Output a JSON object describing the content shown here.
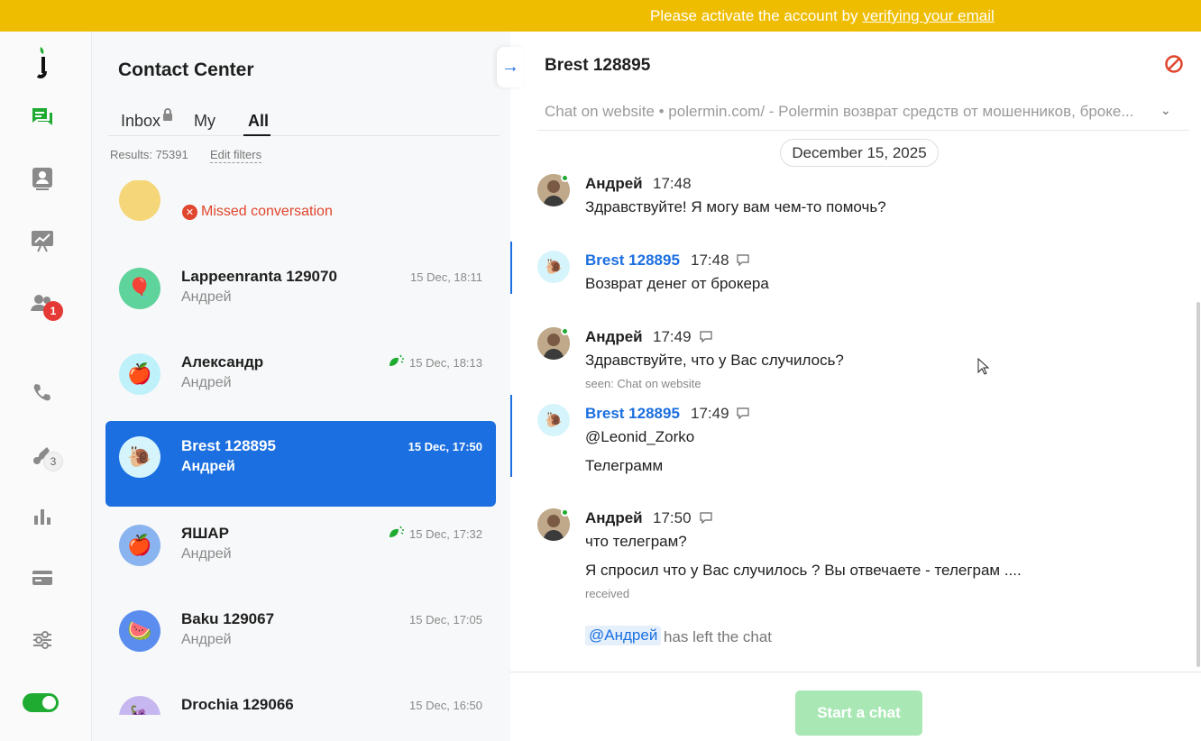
{
  "banner": {
    "prefix": "Please activate the account by ",
    "link": "verifying your email"
  },
  "nav": {
    "badge_contacts": "1",
    "badge_bots": "3"
  },
  "list": {
    "title": "Contact Center",
    "tabs": [
      {
        "label": "Inbox"
      },
      {
        "label": "My"
      },
      {
        "label": "All"
      }
    ],
    "active_tab": "All",
    "results": "Results: 75391",
    "edit_filters": "Edit filters",
    "missed": "Missed conversation",
    "items": [
      {
        "name": "Lappeenranta 129070",
        "sub": "Андрей",
        "time": "15 Dec, 18:11",
        "avatar": "balloon-icon",
        "color": "#5fd39c"
      },
      {
        "name": "Александр",
        "sub": "Андрей",
        "time": "15 Dec, 18:13",
        "avatar": "apple-icon",
        "color": "#bff1fb"
      },
      {
        "name": "Brest 128895",
        "sub": "Андрей",
        "time": "15 Dec, 17:50",
        "avatar": "snail-icon",
        "color": "#d6f4fb"
      },
      {
        "name": "ЯШАР",
        "sub": "Андрей",
        "time": "15 Dec, 17:32",
        "avatar": "apple-icon",
        "color": "#8ab4f0"
      },
      {
        "name": "Baku 129067",
        "sub": "Андрей",
        "time": "15 Dec, 17:05",
        "avatar": "watermelon-icon",
        "color": "#5b8def"
      },
      {
        "name": "Drochia 129066",
        "sub": "",
        "time": "15 Dec, 16:50",
        "avatar": "grapes-icon",
        "color": "#c7b7f0"
      }
    ]
  },
  "chat": {
    "title": "Brest 128895",
    "subtitle": "Chat on website • polermin.com/ - Polermin возврат средств от мошенников, броке...",
    "date": "December 15, 2025",
    "messages": [
      {
        "author": "Андрей",
        "time": "17:48",
        "lines": [
          "Здравствуйте! Я могу вам чем-то помочь?"
        ]
      },
      {
        "author": "Brest 128895",
        "time": "17:48",
        "lines": [
          "Возврат денег от брокера"
        ]
      },
      {
        "author": "Андрей",
        "time": "17:49",
        "lines": [
          "Здравствуйте, что у Вас случилось?"
        ],
        "note": "seen: Chat on website"
      },
      {
        "author": "Brest 128895",
        "time": "17:49",
        "lines": [
          "@Leonid_Zorko",
          "Телеграмм"
        ]
      },
      {
        "author": "Андрей",
        "time": "17:50",
        "lines": [
          "что телеграм?",
          "Я спросил что у Вас случилось ? Вы отвечаете - телеграм ...."
        ],
        "note": "received"
      }
    ],
    "system": {
      "mention": "@Андрей",
      "text": "has left the chat"
    },
    "start_button": "Start a chat"
  },
  "colors": {
    "accent": "#1b6fe0",
    "banner": "#efbd00",
    "success": "#1fab31",
    "danger": "#e0452d"
  }
}
